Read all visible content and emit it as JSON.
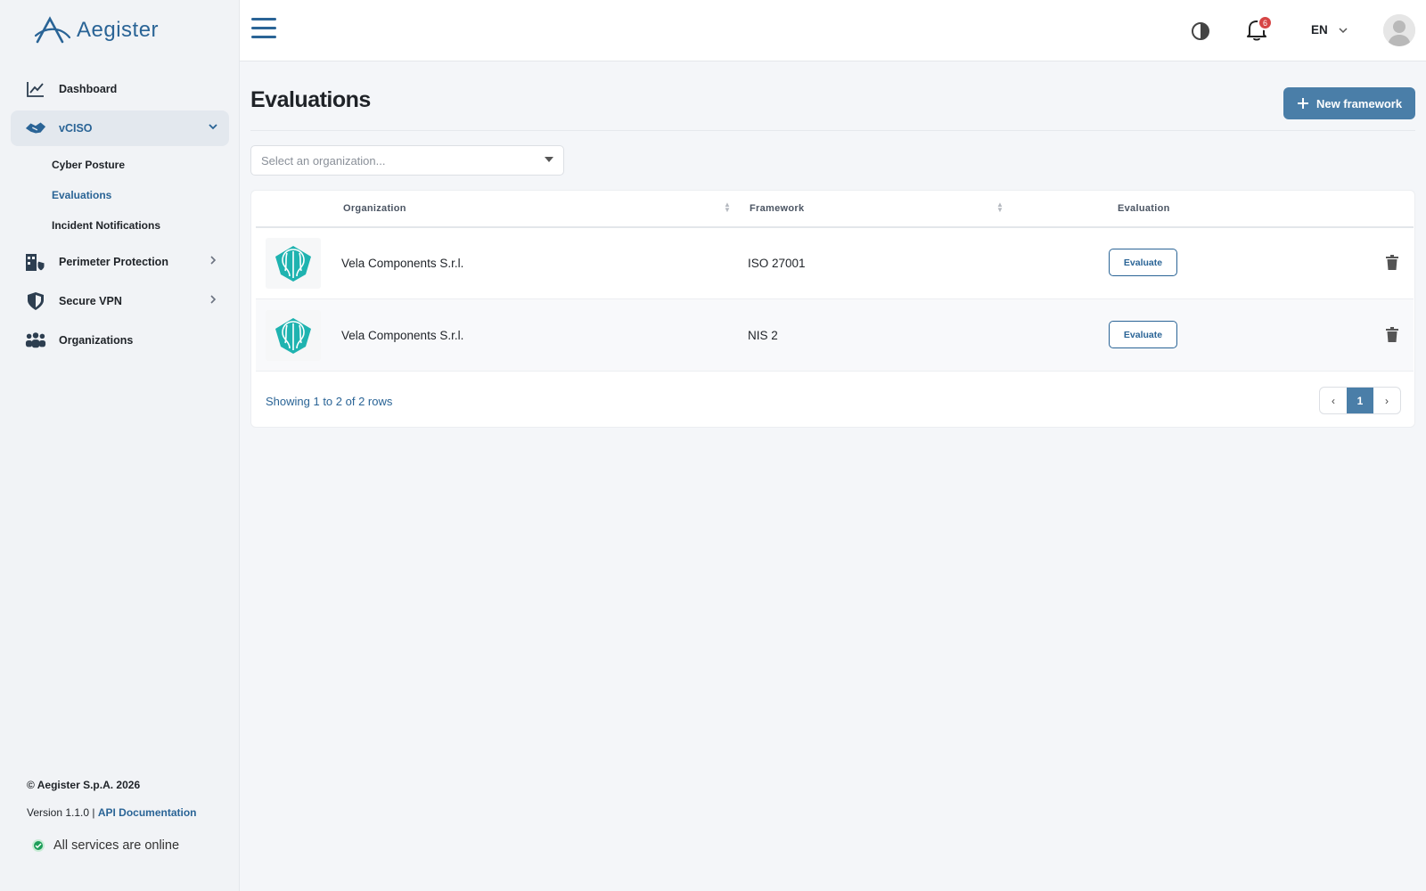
{
  "brand": {
    "name": "Aegister",
    "accent": "#2a6496"
  },
  "sidebar": {
    "items": [
      {
        "label": "Dashboard",
        "icon": "chart-line-icon"
      },
      {
        "label": "vCISO",
        "icon": "handshake-icon",
        "expanded": true
      },
      {
        "label": "Perimeter Protection",
        "icon": "building-shield-icon"
      },
      {
        "label": "Secure VPN",
        "icon": "shield-icon"
      },
      {
        "label": "Organizations",
        "icon": "users-group-icon"
      }
    ],
    "vciso_sub": [
      {
        "label": "Cyber Posture"
      },
      {
        "label": "Evaluations"
      },
      {
        "label": "Incident Notifications"
      }
    ]
  },
  "footer": {
    "copyright": "© Aegister S.p.A. 2026",
    "version_prefix": "Version 1.1.0 | ",
    "api_link": "API Documentation",
    "status": "All services are online"
  },
  "header": {
    "notifications_count": "6",
    "language": "EN"
  },
  "main": {
    "title": "Evaluations",
    "new_button": "New framework",
    "select_placeholder": "Select an organization...",
    "columns": {
      "organization": "Organization",
      "framework": "Framework",
      "evaluation": "Evaluation"
    },
    "rows": [
      {
        "organization": "Vela Components S.r.l.",
        "framework": "ISO 27001",
        "action": "Evaluate"
      },
      {
        "organization": "Vela Components S.r.l.",
        "framework": "NIS 2",
        "action": "Evaluate"
      }
    ],
    "showing": "Showing 1 to 2 of 2 rows",
    "pagination": {
      "prev": "‹",
      "current": "1",
      "next": "›"
    }
  }
}
